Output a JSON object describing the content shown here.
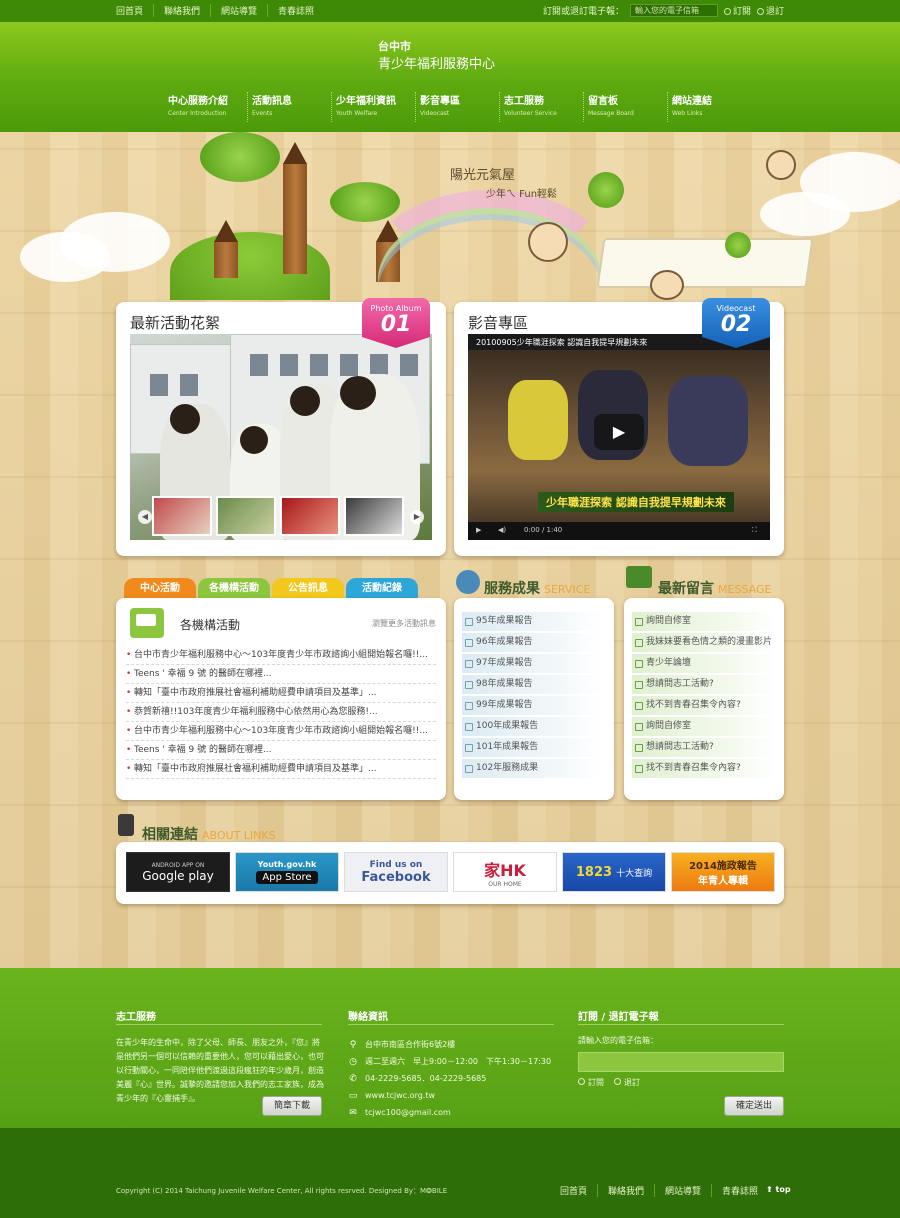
{
  "topbar": {
    "links": [
      "回首頁",
      "聯絡我們",
      "網站導覽",
      "青春誌照"
    ],
    "subscribe_label": "訂閱或退訂電子報：",
    "subscribe_placeholder": "輸入您的電子信箱",
    "subscribe_option": "訂閱",
    "unsubscribe_option": "退訂"
  },
  "header": {
    "logo_line1": "台中市",
    "logo_line2": "青少年福利服務中心",
    "nav": [
      {
        "zh": "中心服務介紹",
        "en": "Center Introduction"
      },
      {
        "zh": "活動訊息",
        "en": "Events"
      },
      {
        "zh": "少年福利資訊",
        "en": "Youth Welfare"
      },
      {
        "zh": "影音專區",
        "en": "Videocast"
      },
      {
        "zh": "志工服務",
        "en": "Volunteer Service"
      },
      {
        "zh": "留言板",
        "en": "Message Board"
      },
      {
        "zh": "網站連結",
        "en": "Web Links"
      }
    ]
  },
  "banner": {
    "slogan_line1": "陽光元氣屋",
    "slogan_line2": "少年ㄟ Fun輕鬆"
  },
  "photo_panel": {
    "title": "最新活動花絮",
    "ribbon_label": "Photo Album",
    "ribbon_num": "01"
  },
  "video_panel": {
    "title": "影音專區",
    "ribbon_label": "Videocast",
    "ribbon_num": "02",
    "video_title": "20100905少年職涯探索 認識自我提早規劃未來",
    "video_banner": "少年職涯探索 認識自我提早規劃未來",
    "time": "0:00 / 1:40"
  },
  "activity": {
    "tabs": [
      {
        "label": "中心活動",
        "color": "#f08a1c"
      },
      {
        "label": "各機構活動",
        "color": "#8cc63e"
      },
      {
        "label": "公告訊息",
        "color": "#f2c81c"
      },
      {
        "label": "活動紀錄",
        "color": "#2ea6d8"
      }
    ],
    "heading": "各機構活動",
    "more": "瀏覽更多活動訊息",
    "items": [
      "台中市青少年福利服務中心～103年度青少年市政諮詢小組開始報名囉!!...",
      "Teens ' 幸福 9 號 的醫師在哪裡...",
      "轉知「臺中市政府推展社會福利補助經費申請項目及基準」...",
      "恭賀新禧!!103年度青少年福利服務中心依然用心為您服務!...",
      "台中市青少年福利服務中心～103年度青少年市政諮詢小組開始報名囉!!...",
      "Teens ' 幸福 9 號 的醫師在哪裡...",
      "轉知「臺中市政府推展社會福利補助經費申請項目及基準」..."
    ]
  },
  "service": {
    "title": "服務成果",
    "title_en": "SERVICE",
    "items": [
      "95年成果報告",
      "96年成果報告",
      "97年成果報告",
      "98年成果報告",
      "99年成果報告",
      "100年成果報告",
      "101年成果報告",
      "102年服務成果"
    ]
  },
  "message": {
    "title": "最新留言",
    "title_en": "MESSAGE",
    "items": [
      "詢問自修室",
      "我妹妹要看色情之類的漫畫影片",
      "青少年論壇",
      "想請問志工活動?",
      "找不到青春召集令內容?",
      "詢問自修室",
      "想請問志工活動?",
      "找不到青春召集令內容?"
    ]
  },
  "links": {
    "title": "相關連結",
    "title_en": "ABOUT LINKS",
    "logos": [
      {
        "line1": "ANDROID APP ON",
        "line2": "Google play"
      },
      {
        "line1": "Youth.gov.hk",
        "line2": "App Store"
      },
      {
        "line1": "Find us on",
        "line2": "Facebook"
      },
      {
        "line1": "家HK",
        "line2": "OUR HOME"
      },
      {
        "line1": "1823",
        "line2": "十大查詢"
      },
      {
        "line1": "2014施政報告",
        "line2": "年青人專輯"
      }
    ]
  },
  "footer": {
    "volunteer_head": "志工服務",
    "volunteer_text": "在青少年的生命中，除了父母、師長、朋友之外，『您』將是他們另一個可以信賴的重要他人，您可以藉出愛心，也可以行動關心，一同陪伴他們渡過這段瘋狂的年少歲月，創造美麗『心』世界。誠摯的邀請您加入我們的志工家族，成為青少年的『心靈捕手』。",
    "download_btn": "簡章下載",
    "contact_head": "聯絡資訊",
    "contact": [
      {
        "icon": "location-icon",
        "text": "台中市南區合作街6號2樓"
      },
      {
        "icon": "clock-icon",
        "text": "週二至週六　早上9:00－12:00　下午1:30－17:30"
      },
      {
        "icon": "phone-icon",
        "text": "04-2229-5685．04-2229-5685"
      },
      {
        "icon": "monitor-icon",
        "text": "www.tcjwc.org.tw"
      },
      {
        "icon": "mail-icon",
        "text": "tcjwc100@gmail.com"
      }
    ],
    "newsletter_head": "訂閱 / 退訂電子報",
    "newsletter_label": "請輸入您的電子信箱：",
    "subscribe": "訂閱",
    "unsubscribe": "退訂",
    "submit_btn": "確定送出"
  },
  "bottom": {
    "copyright": "Copyright (C) 2014 Taichung Juvenile Welfare Center,  All rights resrved.  Designed By：M❂BILE",
    "links": [
      "回首頁",
      "聯絡我們",
      "網站導覽",
      "青春誌照"
    ],
    "top": "top"
  }
}
